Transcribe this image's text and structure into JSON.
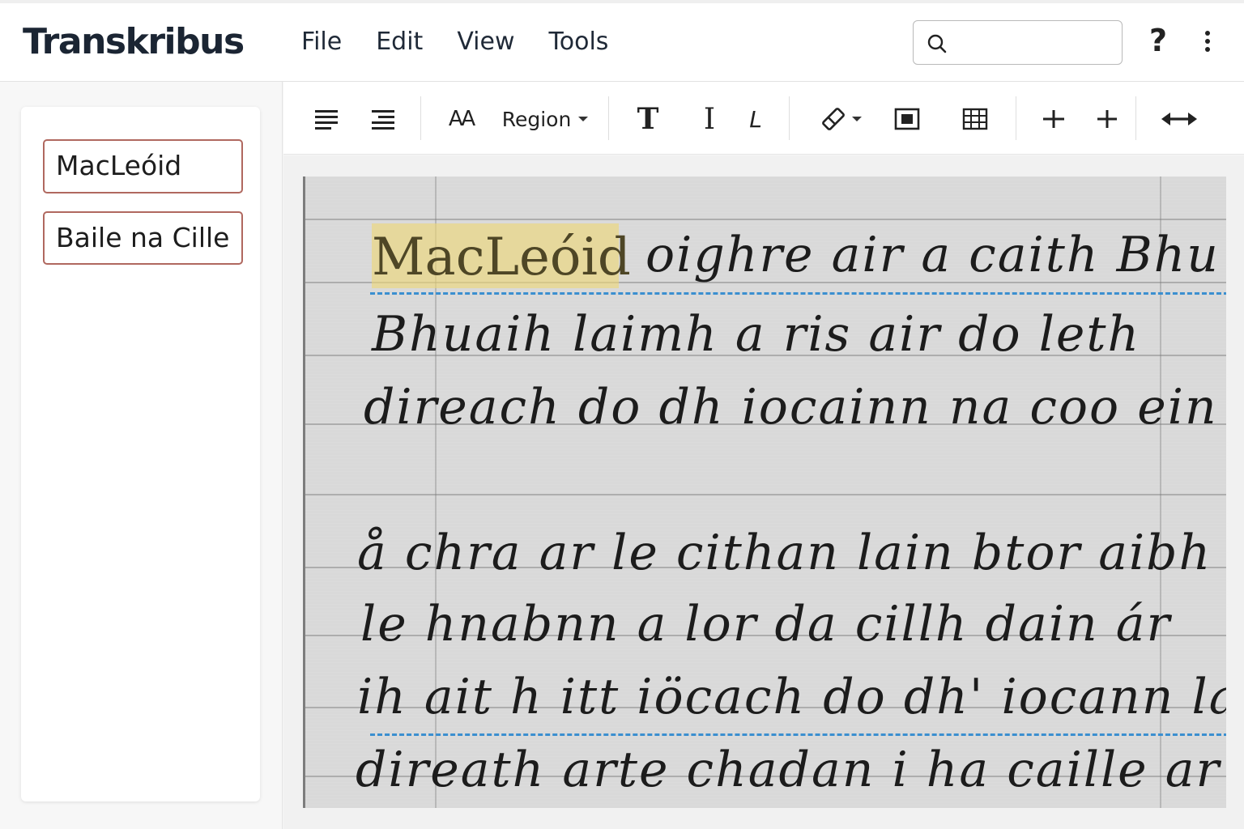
{
  "app": {
    "logo": "Transkribus",
    "menu": [
      "File",
      "Edit",
      "View",
      "Tools"
    ],
    "search": {
      "placeholder": "",
      "value": ""
    },
    "help_label": "?"
  },
  "sidebar": {
    "tags": [
      "MacLeóid",
      "Baile na Cille"
    ]
  },
  "toolbar": {
    "items": [
      {
        "name": "align-left-icon"
      },
      {
        "name": "align-right-icon"
      },
      {
        "name": "font-size-icon",
        "label": "AA"
      },
      {
        "name": "region-dropdown",
        "label": "Region"
      },
      {
        "name": "text-bold-icon",
        "label": "T"
      },
      {
        "name": "text-cursor-icon",
        "label": "I"
      },
      {
        "name": "italic-l-icon",
        "label": "L"
      },
      {
        "name": "eraser-tool-icon"
      },
      {
        "name": "frame-region-icon"
      },
      {
        "name": "table-grid-icon"
      },
      {
        "name": "add-line-icon"
      },
      {
        "name": "add-point-icon"
      },
      {
        "name": "expand-horizontal-icon"
      }
    ]
  },
  "document": {
    "highlighted_word": "MacLeóid",
    "lines": [
      "oighre  air  a  caith Bhu",
      "Bhuaih  laimh  a  ris  air  do leth",
      "direach  do  dh iocainn  na  coo ein",
      "å chra  ar  le  cithan  lain  btor  aibh",
      "le  hnabnn  a lor  da  cillh  dain  ár",
      "ih  ait h   itt  iöcach  do dh' iocann  la",
      "direath  arte  chadan  i  ha  caille  ar"
    ]
  },
  "colors": {
    "tag_border": "#b0685f",
    "highlight": "#eed676",
    "baseline": "#3b8fd0",
    "page_background": "#d9d9d9"
  }
}
